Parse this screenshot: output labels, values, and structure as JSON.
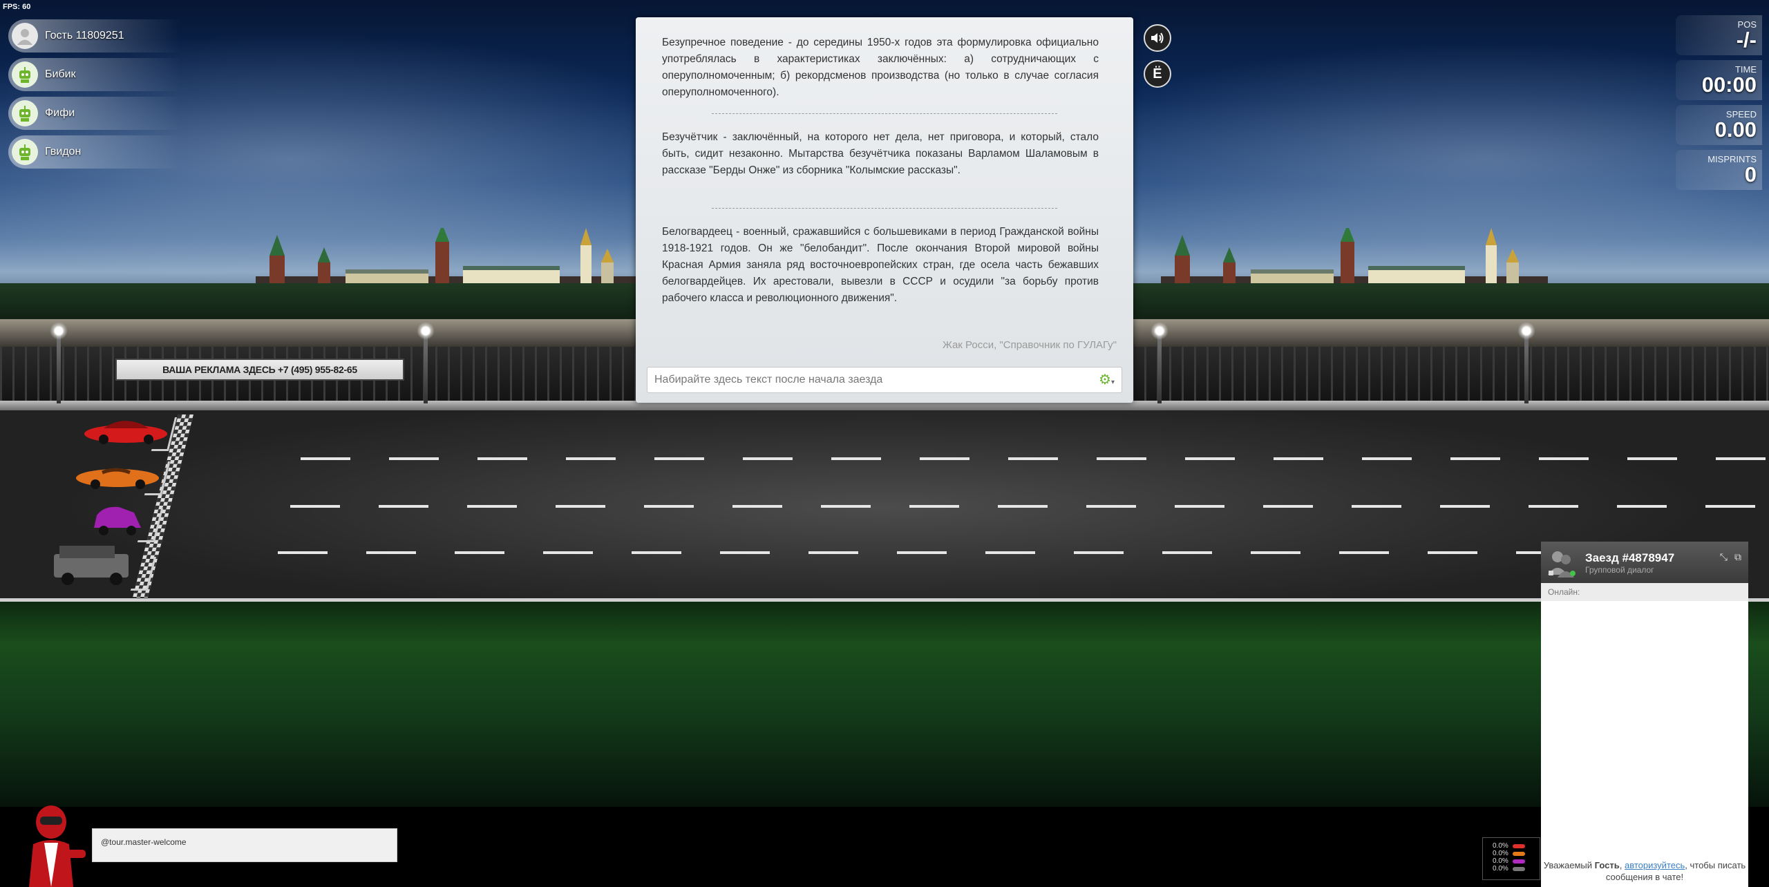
{
  "hud": {
    "fps": "FPS: 60"
  },
  "players": [
    {
      "name": "Гость 11809251",
      "avatar_icon": "user-silhouette-icon",
      "color": "#d9d9d9"
    },
    {
      "name": "Бибик",
      "avatar_icon": "robot-icon",
      "color": "#6cb52c"
    },
    {
      "name": "Фифи",
      "avatar_icon": "robot-icon",
      "color": "#6cb52c"
    },
    {
      "name": "Гвидон",
      "avatar_icon": "robot-icon",
      "color": "#6cb52c"
    }
  ],
  "stats": {
    "pos": {
      "label": "POS",
      "value": "-/-"
    },
    "time": {
      "label": "TIME",
      "value": "00:00"
    },
    "speed": {
      "label": "SPEED",
      "value": "0.00"
    },
    "misprints": {
      "label": "MISPRINTS",
      "value": "0"
    }
  },
  "text_panel": {
    "paragraphs": [
      "Безупречное поведение - до середины 1950-х годов эта формулировка официально употреблялась в характеристиках заключённых: а) сотрудничающих с оперуполномоченным; б) рекордсменов производства (но только в случае согласия оперуполномоченного).",
      "Безучётчик - заключённый, на которого нет дела, нет приговора, и который, стало быть, сидит незаконно. Мытарства безучётчика показаны Варламом Шаламовым в рассказе \"Берды Онже\" из сборника \"Колымские рассказы\".",
      "Белогвардеец - военный, сражавшийся с большевиками в период Гражданской войны 1918-1921 годов. Он же \"белобандит\". После окончания Второй мировой войны Красная Армия заняла ряд восточноевропейских стран, где осела часть бежавших белогвардейцев. Их арестовали, вывезли в СССР и осудили \"за борьбу против рабочего класса и революционного движения\"."
    ],
    "source": "Жак Росси, \"Справочник по ГУЛАГу\"",
    "input_placeholder": "Набирайте здесь текст после начала заезда",
    "settings_icon": "gears-icon"
  },
  "side_buttons": {
    "sound_icon": "speaker-icon",
    "yo_label": "Ё"
  },
  "ad_banner": "ВАША РЕКЛАМА ЗДЕСЬ +7 (495) 955-82-65",
  "chat": {
    "title": "Заезд #4878947",
    "subtitle": "Групповой диалог",
    "online_label": "Онлайн:",
    "footer_prefix": "Уважаемый ",
    "footer_guest": "Гость",
    "footer_comma": ", ",
    "footer_link": "авторизуйтесь",
    "footer_suffix": ", чтобы писать сообщения в чате!"
  },
  "bottom_message": "@tour.master-welcome",
  "progress_rows": [
    {
      "value": "0.0%",
      "color": "#e0302a"
    },
    {
      "value": "0.0%",
      "color": "#e67a1a"
    },
    {
      "value": "0.0%",
      "color": "#b02ac0"
    },
    {
      "value": "0.0%",
      "color": "#777777"
    }
  ],
  "cars": [
    {
      "name": "red-sports-car",
      "color": "#d41a1a"
    },
    {
      "name": "orange-convertible",
      "color": "#e0701a"
    },
    {
      "name": "purple-hatchback",
      "color": "#a020b0"
    },
    {
      "name": "grey-suv",
      "color": "#6a6a6a"
    }
  ]
}
